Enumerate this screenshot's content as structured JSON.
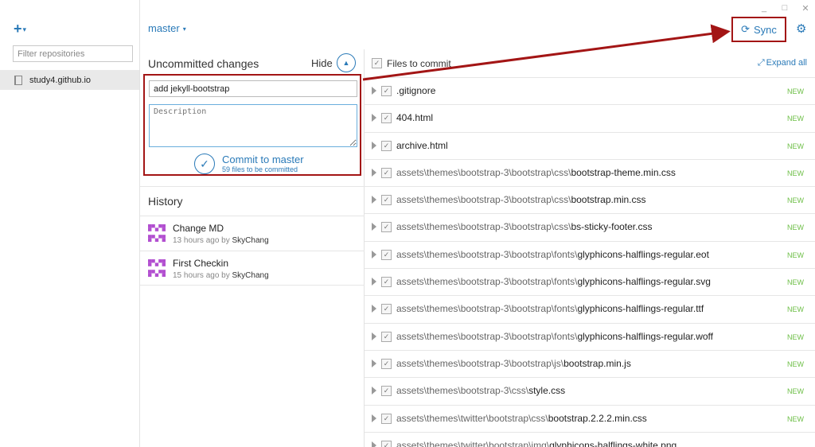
{
  "window": {
    "minimize_glyph": "_",
    "maximize_glyph": "□",
    "close_glyph": "✕"
  },
  "sidebar": {
    "add_glyph": "+",
    "add_caret": "▾",
    "filter_placeholder": "Filter repositories",
    "repositories": [
      {
        "name": "study4.github.io",
        "icon": "book-icon"
      }
    ]
  },
  "branch": {
    "name": "master",
    "caret": "▾"
  },
  "uncommitted": {
    "title": "Uncommitted changes",
    "hide_label": "Hide",
    "hide_icon": "chevron-up-icon",
    "summary_value": "add jekyll-bootstrap",
    "description_placeholder": "Description",
    "commit_label": "Commit to master",
    "commit_sub": "59 files to be committed"
  },
  "history": {
    "title": "History",
    "items": [
      {
        "message": "Change MD",
        "time": "13 hours ago",
        "by": "by",
        "author": "SkyChang"
      },
      {
        "message": "First Checkin",
        "time": "15 hours ago",
        "by": "by",
        "author": "SkyChang"
      }
    ]
  },
  "files": {
    "header_label": "Files to commit",
    "expand_all_label": "Expand all",
    "status_new": "NEW",
    "items": [
      {
        "dir": "",
        "name": ".gitignore",
        "status": "NEW"
      },
      {
        "dir": "",
        "name": "404.html",
        "status": "NEW"
      },
      {
        "dir": "",
        "name": "archive.html",
        "status": "NEW"
      },
      {
        "dir": "assets\\themes\\bootstrap-3\\bootstrap\\css\\",
        "name": "bootstrap-theme.min.css",
        "status": "NEW"
      },
      {
        "dir": "assets\\themes\\bootstrap-3\\bootstrap\\css\\",
        "name": "bootstrap.min.css",
        "status": "NEW"
      },
      {
        "dir": "assets\\themes\\bootstrap-3\\bootstrap\\css\\",
        "name": "bs-sticky-footer.css",
        "status": "NEW"
      },
      {
        "dir": "assets\\themes\\bootstrap-3\\bootstrap\\fonts\\",
        "name": "glyphicons-halflings-regular.eot",
        "status": "NEW"
      },
      {
        "dir": "assets\\themes\\bootstrap-3\\bootstrap\\fonts\\",
        "name": "glyphicons-halflings-regular.svg",
        "status": "NEW"
      },
      {
        "dir": "assets\\themes\\bootstrap-3\\bootstrap\\fonts\\",
        "name": "glyphicons-halflings-regular.ttf",
        "status": "NEW"
      },
      {
        "dir": "assets\\themes\\bootstrap-3\\bootstrap\\fonts\\",
        "name": "glyphicons-halflings-regular.woff",
        "status": "NEW"
      },
      {
        "dir": "assets\\themes\\bootstrap-3\\bootstrap\\js\\",
        "name": "bootstrap.min.js",
        "status": "NEW"
      },
      {
        "dir": "assets\\themes\\bootstrap-3\\css\\",
        "name": "style.css",
        "status": "NEW"
      },
      {
        "dir": "assets\\themes\\twitter\\bootstrap\\css\\",
        "name": "bootstrap.2.2.2.min.css",
        "status": "NEW"
      },
      {
        "dir": "assets\\themes\\twitter\\bootstrap\\img\\",
        "name": "glyphicons-halflings-white.png",
        "status": ""
      }
    ]
  },
  "sync": {
    "label": "Sync",
    "icon": "sync-icon"
  },
  "settings": {
    "icon": "gear-icon"
  },
  "colors": {
    "accent": "#2a7ab8",
    "annotation": "#a31515",
    "status_new": "#6cbe45",
    "avatar": "#b24fd0"
  }
}
